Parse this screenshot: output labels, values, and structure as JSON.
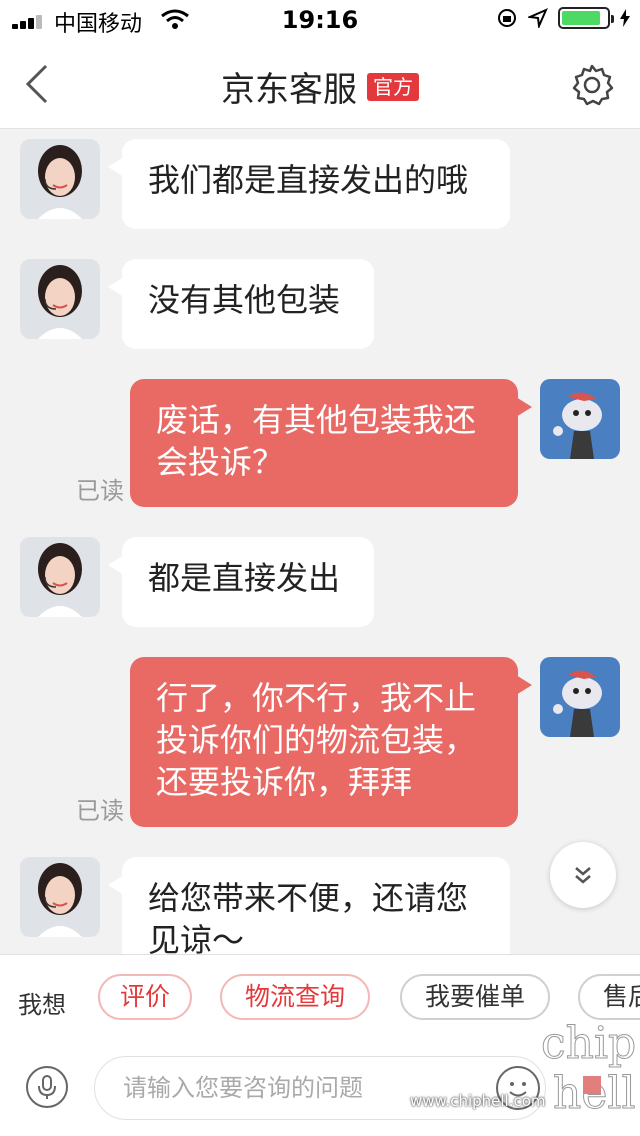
{
  "status_bar": {
    "carrier": "中国移动",
    "time": "19:16",
    "battery_color": "#4cd964"
  },
  "nav": {
    "title": "京东客服",
    "badge": "官方"
  },
  "messages": [
    {
      "side": "left",
      "text": "我们都是直接发出的哦"
    },
    {
      "side": "left",
      "text": "没有其他包装"
    },
    {
      "side": "right",
      "lines": [
        "废话，有其他包装我还",
        "会投诉？"
      ],
      "status": "已读"
    },
    {
      "side": "left",
      "text": "都是直接发出"
    },
    {
      "side": "right",
      "lines": [
        "行了，你不行，我不止",
        "投诉你们的物流包装，",
        "还要投诉你，拜拜"
      ],
      "status": "已读"
    },
    {
      "side": "left",
      "lines": [
        "给您带来不便，还请您",
        "见谅～"
      ]
    }
  ],
  "quick_bar": {
    "label": "我想",
    "chips": [
      "评价",
      "物流查询",
      "我要催单",
      "售后"
    ]
  },
  "input": {
    "placeholder": "请输入您要咨询的问题"
  },
  "watermark": {
    "text": "chip hell",
    "url": "www.chiphell.com"
  },
  "colors": {
    "accent": "#e4393c",
    "bubble_right": "#e96a65",
    "bubble_left": "#ffffff",
    "background": "#f2f2f2"
  }
}
